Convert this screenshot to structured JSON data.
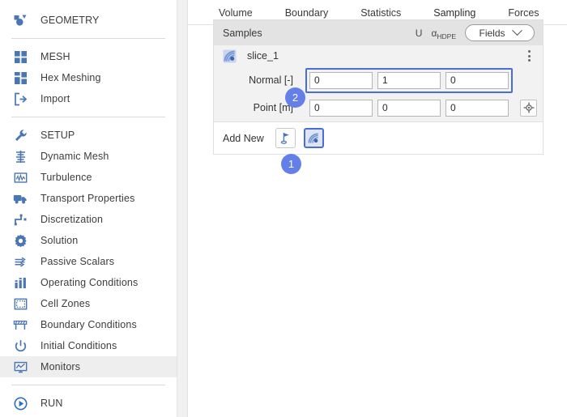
{
  "sidebar": {
    "groups": [
      {
        "items": [
          {
            "label": "GEOMETRY",
            "icon": "geometry-icon",
            "selected": false
          }
        ]
      },
      {
        "items": [
          {
            "label": "MESH",
            "icon": "mesh-icon",
            "selected": false
          },
          {
            "label": "Hex Meshing",
            "icon": "hex-meshing-icon",
            "selected": false
          },
          {
            "label": "Import",
            "icon": "import-icon",
            "selected": false
          }
        ]
      },
      {
        "items": [
          {
            "label": "SETUP",
            "icon": "wrench-icon",
            "selected": false
          },
          {
            "label": "Dynamic Mesh",
            "icon": "dynamic-mesh-icon",
            "selected": false
          },
          {
            "label": "Turbulence",
            "icon": "turbulence-icon",
            "selected": false
          },
          {
            "label": "Transport Properties",
            "icon": "truck-icon",
            "selected": false
          },
          {
            "label": "Discretization",
            "icon": "discretization-icon",
            "selected": false
          },
          {
            "label": "Solution",
            "icon": "gear-icon",
            "selected": false
          },
          {
            "label": "Passive Scalars",
            "icon": "passive-scalars-icon",
            "selected": false
          },
          {
            "label": "Operating Conditions",
            "icon": "bar-chart-icon",
            "selected": false
          },
          {
            "label": "Cell Zones",
            "icon": "cell-zones-icon",
            "selected": false
          },
          {
            "label": "Boundary Conditions",
            "icon": "boundary-conditions-icon",
            "selected": false
          },
          {
            "label": "Initial Conditions",
            "icon": "power-icon",
            "selected": false
          },
          {
            "label": "Monitors",
            "icon": "monitors-icon",
            "selected": true
          }
        ]
      },
      {
        "items": [
          {
            "label": "RUN",
            "icon": "play-icon",
            "selected": false
          }
        ]
      }
    ]
  },
  "tabs": [
    {
      "label": "Volume",
      "active": false
    },
    {
      "label": "Boundary",
      "active": false
    },
    {
      "label": "Statistics",
      "active": false
    },
    {
      "label": "Sampling",
      "active": true
    },
    {
      "label": "Forces",
      "active": false
    }
  ],
  "panel": {
    "title": "Samples",
    "field_tags": [
      {
        "base": "U",
        "sub": ""
      },
      {
        "base": "α",
        "sub": "HDPE"
      }
    ],
    "fields_button": {
      "label": "Fields",
      "icon": "chevron-down-icon"
    },
    "sample_item": {
      "name": "slice_1",
      "icon": "slice-icon",
      "menu_icon": "kebab-menu-icon"
    },
    "rows": [
      {
        "label": "Normal [-]",
        "values": [
          "0",
          "1",
          "0"
        ],
        "highlighted": true,
        "has_picker": false
      },
      {
        "label": "Point [m]",
        "values": [
          "0",
          "0",
          "0"
        ],
        "highlighted": false,
        "has_picker": true,
        "picker_icon": "crosshair-icon"
      }
    ],
    "add_new": {
      "label": "Add New",
      "buttons": [
        {
          "icon": "probe-flag-icon",
          "selected": false
        },
        {
          "icon": "slice-icon",
          "selected": true
        }
      ]
    }
  },
  "callouts": [
    {
      "id": "1",
      "label": "1"
    },
    {
      "id": "2",
      "label": "2"
    }
  ],
  "colors": {
    "accent": "#4a6fd4",
    "badge": "#6480e8",
    "icon_blue": "#4a77b4",
    "panel_header": "#e3e3e3",
    "panel_body": "#f2f2f2"
  }
}
